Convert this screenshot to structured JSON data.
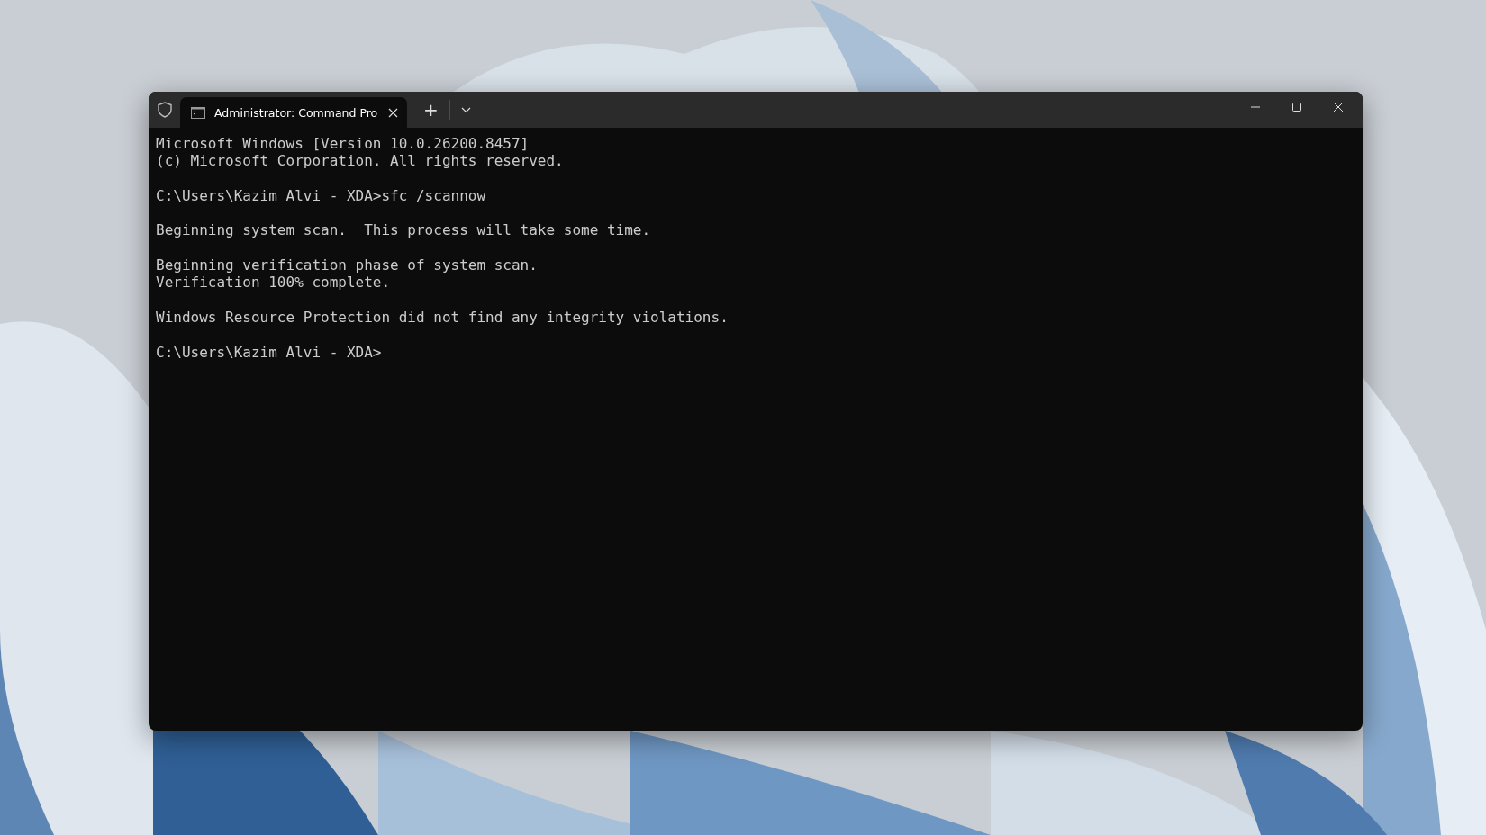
{
  "window": {
    "tabs": [
      {
        "title": "Administrator: Command Pro",
        "selected": true
      }
    ],
    "new_tab": "+",
    "terminal": {
      "paragraphs": [
        [
          "Microsoft Windows [Version 10.0.26200.8457]",
          "(c) Microsoft Corporation. All rights reserved."
        ],
        [
          "C:\\Users\\Kazim Alvi - XDA>sfc /scannow"
        ],
        [
          "Beginning system scan.  This process will take some time."
        ],
        [
          "Beginning verification phase of system scan.",
          "Verification 100% complete."
        ],
        [
          "Windows Resource Protection did not find any integrity violations."
        ],
        [
          "C:\\Users\\Kazim Alvi - XDA>"
        ]
      ]
    }
  }
}
